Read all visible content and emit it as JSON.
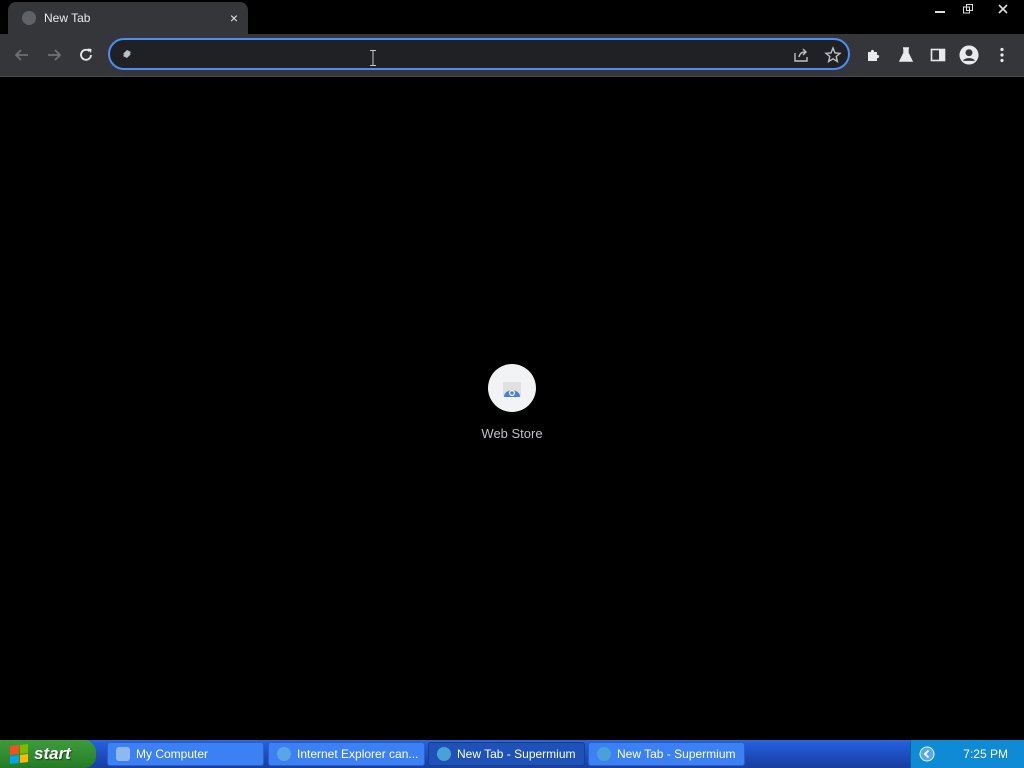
{
  "window": {
    "tab": {
      "title": "New Tab",
      "favicon": "globe-icon",
      "close": "×"
    },
    "controls": {
      "minimize": "minimize-icon",
      "restore": "restore-icon",
      "close": "close-icon"
    }
  },
  "toolbar": {
    "back": "back-arrow-icon",
    "forward": "forward-arrow-icon",
    "reload": "reload-icon",
    "omnibox": {
      "value": "",
      "placeholder": ""
    },
    "share": "share-icon",
    "bookmark": "star-icon",
    "extensions": "puzzle-icon",
    "labs": "flask-icon",
    "sidepanel": "side-panel-icon",
    "profile": "profile-icon",
    "menu": "kebab-menu-icon",
    "accent": "#4c8df6"
  },
  "content": {
    "shortcuts": [
      {
        "label": "Web Store"
      }
    ]
  },
  "taskbar": {
    "start": "start",
    "tasks": [
      {
        "label": "My Computer",
        "active": false
      },
      {
        "label": "Internet Explorer can...",
        "active": false
      },
      {
        "label": "New Tab - Supermium",
        "active": true
      },
      {
        "label": "New Tab - Supermium",
        "active": false
      }
    ],
    "clock": "7:25 PM"
  }
}
